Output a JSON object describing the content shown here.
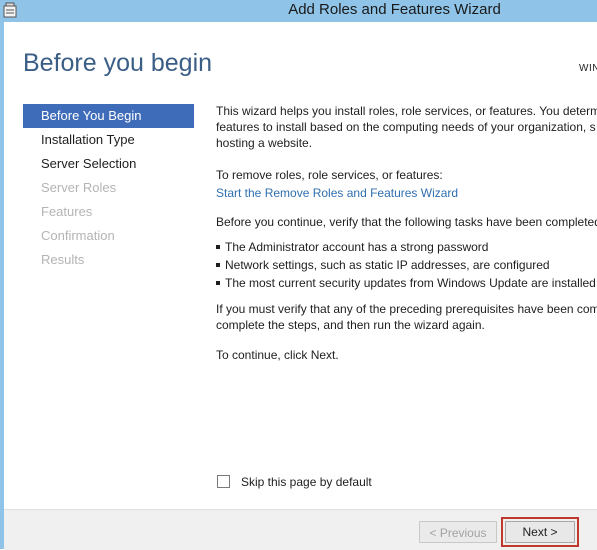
{
  "window": {
    "title": "Add Roles and Features Wizard"
  },
  "header": {
    "page_title": "Before you begin",
    "server_name": "WIN"
  },
  "nav": {
    "items": [
      {
        "label": "Before You Begin",
        "state": "active"
      },
      {
        "label": "Installation Type",
        "state": "enabled"
      },
      {
        "label": "Server Selection",
        "state": "enabled"
      },
      {
        "label": "Server Roles",
        "state": "disabled"
      },
      {
        "label": "Features",
        "state": "disabled"
      },
      {
        "label": "Confirmation",
        "state": "disabled"
      },
      {
        "label": "Results",
        "state": "disabled"
      }
    ]
  },
  "content": {
    "intro_line1": "This wizard helps you install roles, role services, or features. You determi",
    "intro_line2": "features to install based on the computing needs of your organization, s",
    "intro_line3": "hosting a website.",
    "remove_heading": "To remove roles, role services, or features:",
    "remove_link": "Start the Remove Roles and Features Wizard",
    "verify_text": "Before you continue, verify that the following tasks have been completed",
    "tasks": [
      "The Administrator account has a strong password",
      "Network settings, such as static IP addresses, are configured",
      "The most current security updates from Windows Update are installed"
    ],
    "prereq_line1": "If you must verify that any of the preceding prerequisites have been com",
    "prereq_line2": "complete the steps, and then run the wizard again.",
    "continue_text": "To continue, click Next."
  },
  "skip": {
    "label": "Skip this page by default",
    "checked": false
  },
  "footer": {
    "previous_label": "< Previous",
    "next_label": "Next >"
  },
  "colors": {
    "titlebar": "#8fc3e8",
    "nav_active": "#3f6cb9",
    "heading": "#3b5e86",
    "link": "#2f6fb0",
    "highlight": "#c0392b"
  }
}
